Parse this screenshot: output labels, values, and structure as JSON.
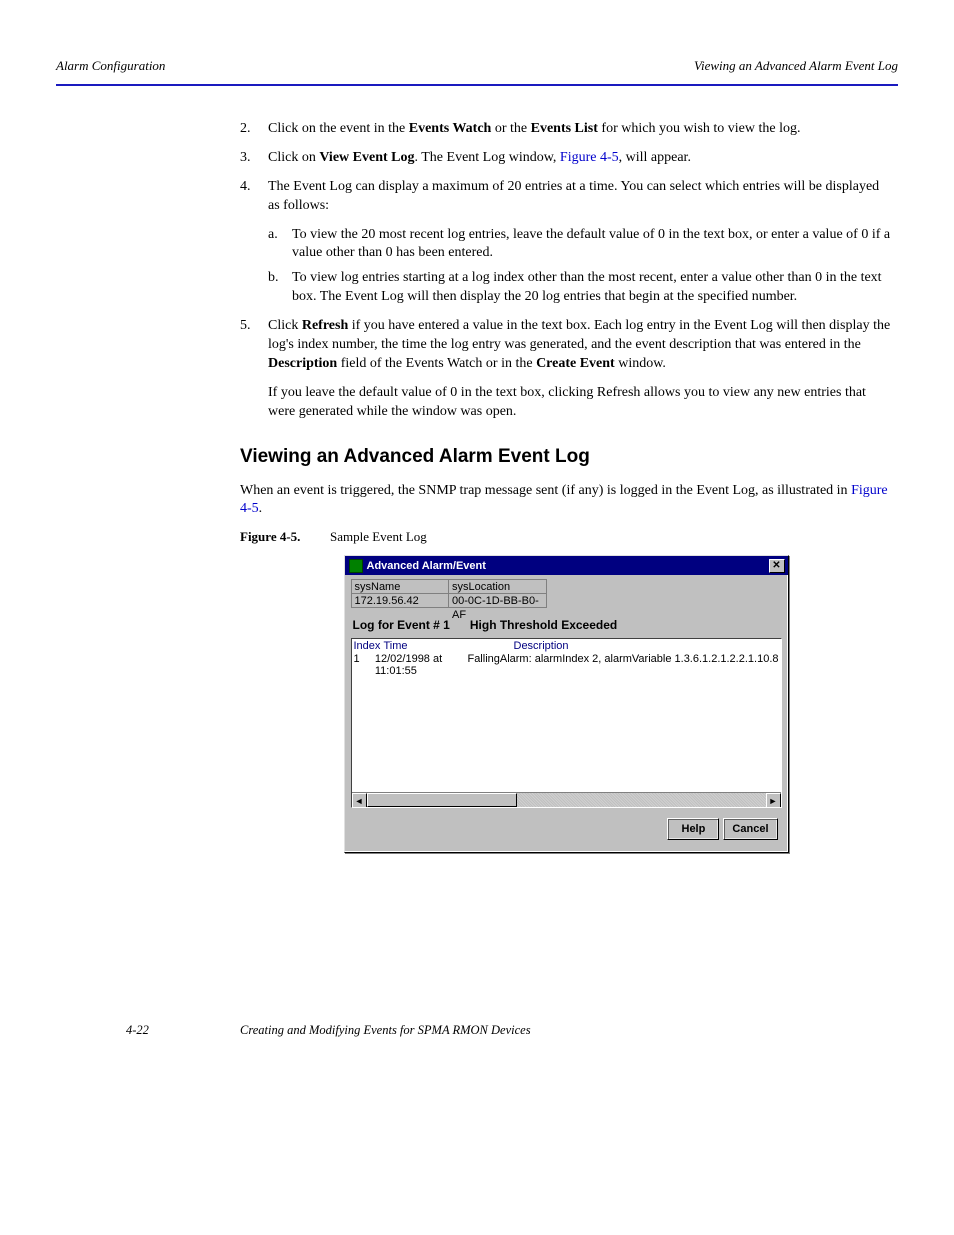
{
  "header": {
    "left": "Alarm Configuration",
    "right": "Viewing an Advanced Alarm Event Log"
  },
  "steps": {
    "s2": {
      "num": "2.",
      "text_a": "Click on the event in the ",
      "bold1": "Events Watch",
      "text_b": " or the ",
      "bold2": "Events List",
      "text_c": " for which you wish to view the log."
    },
    "s3": {
      "num": "3.",
      "text_a": "Click on ",
      "bold1": "View Event Log",
      "text_b": ". The Event Log window, "
    },
    "s3_link": "Figure 4-5",
    "s3_tail": ", will appear.",
    "s4": {
      "num": "4.",
      "text": "The Event Log can display a maximum of 20 entries at a time. You can select which entries will be displayed as follows:"
    },
    "s4a": {
      "num": "a.",
      "text": "To view the 20 most recent log entries, leave the default value of 0 in the text box, or enter a value of 0 if a value other than 0 has been entered."
    },
    "s4b": {
      "num": "b.",
      "text": "To view log entries starting at a log index other than the most recent, enter a value other than 0 in the text box. The Event Log will then display the 20 log entries that begin at the specified number."
    },
    "s5": {
      "num": "5.",
      "text_a": "Click ",
      "bold1": "Refresh",
      "text_b": " if you have entered a value in the text box. Each log entry in the Event Log will then display the log's index number, the time the log entry was generated, and the event description that was entered in the ",
      "bold2": "Description",
      "text_c": " field of the Events Watch or in the ",
      "bold3": "Create Event",
      "text_d": " window."
    }
  },
  "note": "If you leave the default value of 0 in the text box, clicking Refresh allows you to view any new entries that were generated while the window was open.",
  "section_title": "Viewing an Advanced Alarm Event Log",
  "section_para_a": "When an event is triggered, the SNMP trap message sent (if any) is logged in the Event Log, as illustrated in ",
  "section_link": "Figure 4-5",
  "section_para_b": ".",
  "figure": {
    "label": "Figure 4-5.",
    "caption": "Sample Event Log"
  },
  "dialog": {
    "title": "Advanced Alarm/Event",
    "sysNameLabel": "sysName",
    "sysNameValue": "172.19.56.42",
    "sysLocationLabel": "sysLocation",
    "sysLocationValue": "00-0C-1D-BB-B0-AF",
    "log_title_a": "Log for Event # 1",
    "log_title_b": "High Threshold Exceeded",
    "columns": {
      "index": "Index",
      "time": "Time",
      "desc": "Description"
    },
    "row": {
      "index": "1",
      "time": "12/02/1998 at 11:01:55",
      "desc": "FallingAlarm: alarmIndex 2, alarmVariable 1.3.6.1.2.1.2.2.1.10.8"
    },
    "buttons": {
      "help": "Help",
      "cancel": "Cancel"
    },
    "scroll_left": "◄",
    "scroll_right": "►",
    "close_x": "✕"
  },
  "footer": {
    "pagenum": "4-22",
    "text": "Creating and Modifying Events for SPMA RMON Devices"
  }
}
